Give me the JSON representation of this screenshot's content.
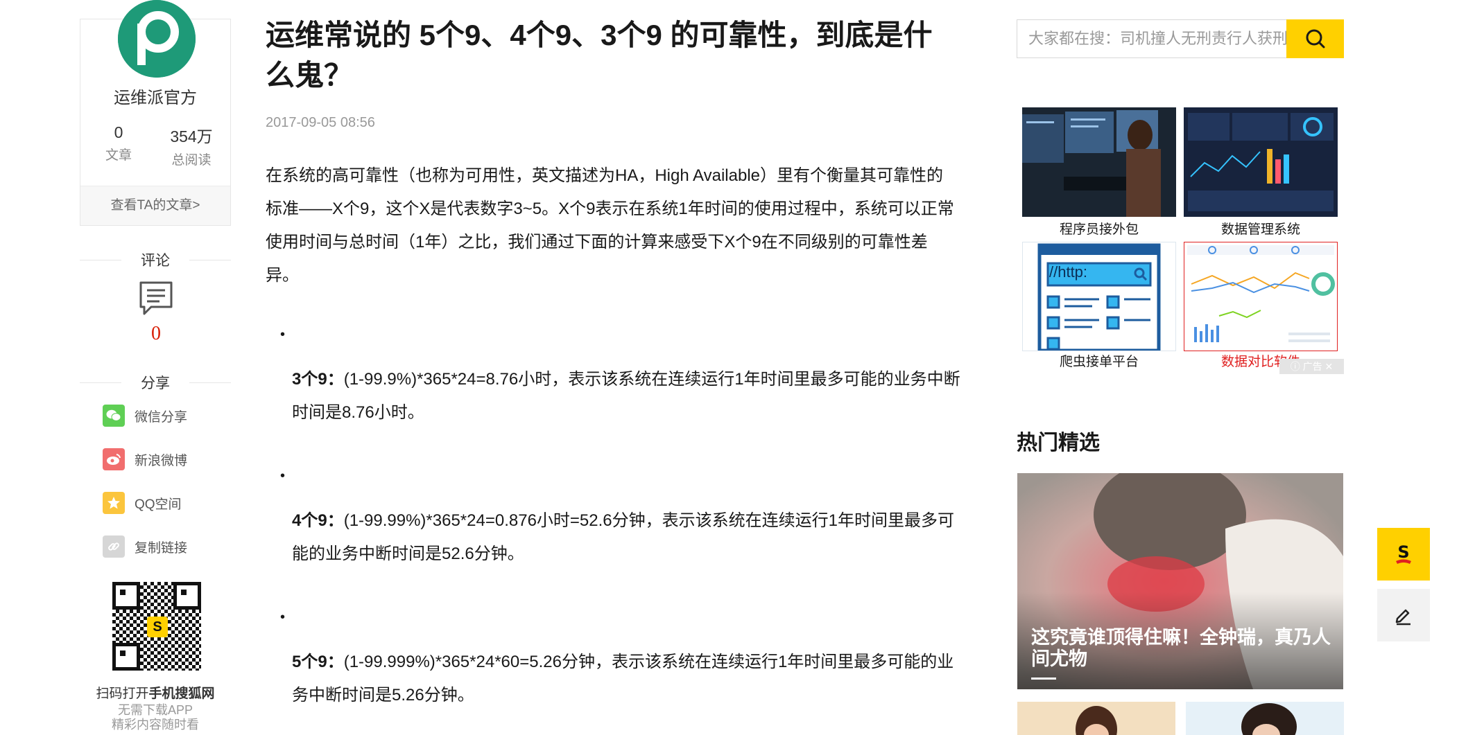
{
  "author": {
    "name": "运维派官方",
    "avatar_letter": "P",
    "stats": [
      {
        "value": "0",
        "label": "文章"
      },
      {
        "value": "354万",
        "label": "总阅读"
      }
    ],
    "view_articles": "查看TA的文章>"
  },
  "comments": {
    "title": "评论",
    "count": "0"
  },
  "share": {
    "title": "分享",
    "items": [
      {
        "label": "微信分享",
        "icon": "wechat-icon",
        "color": "#5fcf55"
      },
      {
        "label": "新浪微博",
        "icon": "weibo-icon",
        "color": "#f16e6e"
      },
      {
        "label": "QQ空间",
        "icon": "qzone-icon",
        "color": "#fbc53d"
      },
      {
        "label": "复制链接",
        "icon": "link-icon",
        "color": "#d6d6d6"
      }
    ]
  },
  "qr": {
    "line1_prefix": "扫码打开",
    "line1_strong": "手机搜狐网",
    "line2": "无需下载APP",
    "line3": "精彩内容随时看"
  },
  "article": {
    "title": "运维常说的 5个9、4个9、3个9 的可靠性，到底是什么鬼？",
    "date": "2017-09-05 08:56",
    "intro": "在系统的高可靠性（也称为可用性，英文描述为HA，High Available）里有个衡量其可靠性的标准——X个9，这个X是代表数字3~5。X个9表示在系统1年时间的使用过程中，系统可以正常使用时间与总时间（1年）之比，我们通过下面的计算来感受下X个9在不同级别的可靠性差异。",
    "list": [
      {
        "label": "3个9：",
        "text": "(1-99.9%)*365*24=8.76小时，表示该系统在连续运行1年时间里最多可能的业务中断时间是8.76小时。"
      },
      {
        "label": "4个9：",
        "text": "(1-99.99%)*365*24=0.876小时=52.6分钟，表示该系统在连续运行1年时间里最多可能的业务中断时间是52.6分钟。"
      },
      {
        "label": "5个9：",
        "text": "(1-99.999%)*365*24*60=5.26分钟，表示该系统在连续运行1年时间里最多可能的业务中断时间是5.26分钟。"
      }
    ]
  },
  "search": {
    "placeholder": "大家都在搜：司机撞人无刑责行人获刑"
  },
  "ads": {
    "items": [
      {
        "label": "程序员接外包",
        "label_color": "#191919"
      },
      {
        "label": "数据管理系统",
        "label_color": "#191919"
      },
      {
        "label": "爬虫接单平台",
        "label_color": "#191919",
        "url_text": "//http:"
      },
      {
        "label": "数据对比软件",
        "label_color": "#e02020"
      }
    ],
    "ad_mark": "广告"
  },
  "hot": {
    "title": "热门精选",
    "feature_caption": "这究竟谁顶得住嘛！全钟瑞，真乃人间尤物"
  },
  "float_buttons": [
    {
      "name": "sohu-app-button",
      "icon": "sohu-s-icon",
      "bg": "#ffd000"
    },
    {
      "name": "write-button",
      "icon": "edit-pen-icon",
      "bg": "#f2f2f2"
    }
  ]
}
